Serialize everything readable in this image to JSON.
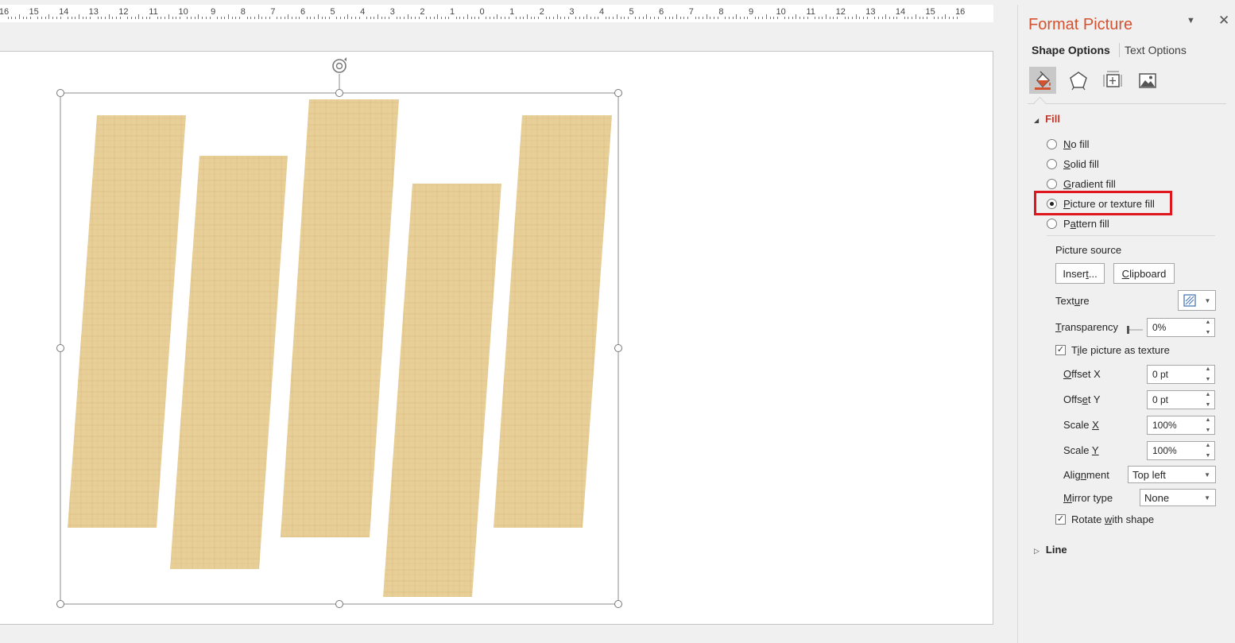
{
  "ruler": {
    "labels": [
      "16",
      "15",
      "14",
      "13",
      "12",
      "11",
      "10",
      "9",
      "8",
      "7",
      "6",
      "5",
      "4",
      "3",
      "2",
      "1",
      "0",
      "1",
      "2",
      "3",
      "4",
      "5",
      "6",
      "7",
      "8",
      "9",
      "10",
      "11",
      "12",
      "13",
      "14",
      "15",
      "16"
    ]
  },
  "panel": {
    "title": "Format Picture",
    "tabs": {
      "shape": "Shape Options",
      "text": "Text Options"
    },
    "icons": [
      "fill-line-icon",
      "effects-pentagon-icon",
      "size-properties-icon",
      "picture-icon"
    ],
    "fill": {
      "heading": "Fill",
      "options": [
        {
          "label": "No fill",
          "key": "N",
          "rest": "o fill",
          "checked": false
        },
        {
          "label": "Solid fill",
          "key": "S",
          "rest": "olid fill",
          "checked": false
        },
        {
          "label": "Gradient fill",
          "key": "G",
          "rest": "radient fill",
          "checked": false
        },
        {
          "label": "Picture or texture fill",
          "key": "P",
          "rest": "icture or texture fill",
          "checked": true
        },
        {
          "label": "Pattern fill",
          "key": "A",
          "pre": "P",
          "mid": "a",
          "rest": "ttern fill",
          "checked": false
        }
      ],
      "picture_source_label": "Picture source",
      "insert_button": {
        "pre": "Inser",
        "key": "t",
        "post": "..."
      },
      "clipboard_button": {
        "pre": "",
        "key": "C",
        "post": "lipboard"
      },
      "texture_label": {
        "pre": "Text",
        "key": "u",
        "post": "re"
      },
      "transparency_label": {
        "pre": "",
        "key": "T",
        "post": "ransparency"
      },
      "transparency_value": "0%",
      "tile_label": {
        "pre": "T",
        "key": "i",
        "post": "le picture as texture"
      },
      "tile_checked": true,
      "offset_x_label": {
        "pre": "",
        "key": "O",
        "post": "ffset X"
      },
      "offset_x_value": "0 pt",
      "offset_y_label": {
        "pre": "Offs",
        "key": "e",
        "post": "t Y"
      },
      "offset_y_value": "0 pt",
      "scale_x_label": {
        "pre": "Scale ",
        "key": "X",
        "post": ""
      },
      "scale_x_value": "100%",
      "scale_y_label": {
        "pre": "Scale ",
        "key": "Y",
        "post": ""
      },
      "scale_y_value": "100%",
      "alignment_label": {
        "pre": "Alig",
        "key": "n",
        "post": "ment"
      },
      "alignment_value": "Top left",
      "mirror_label": {
        "pre": "",
        "key": "M",
        "post": "irror type"
      },
      "mirror_value": "None",
      "rotate_label": {
        "pre": "Rotate ",
        "key": "w",
        "post": "ith shape"
      },
      "rotate_checked": true
    },
    "line": {
      "heading": "Line"
    }
  },
  "colors": {
    "accent": "#d35230",
    "fill_heading": "#c0392b",
    "highlight": "#e0161e",
    "papyrus": "#e8cf97",
    "papyrus_dark": "#c9a766"
  }
}
